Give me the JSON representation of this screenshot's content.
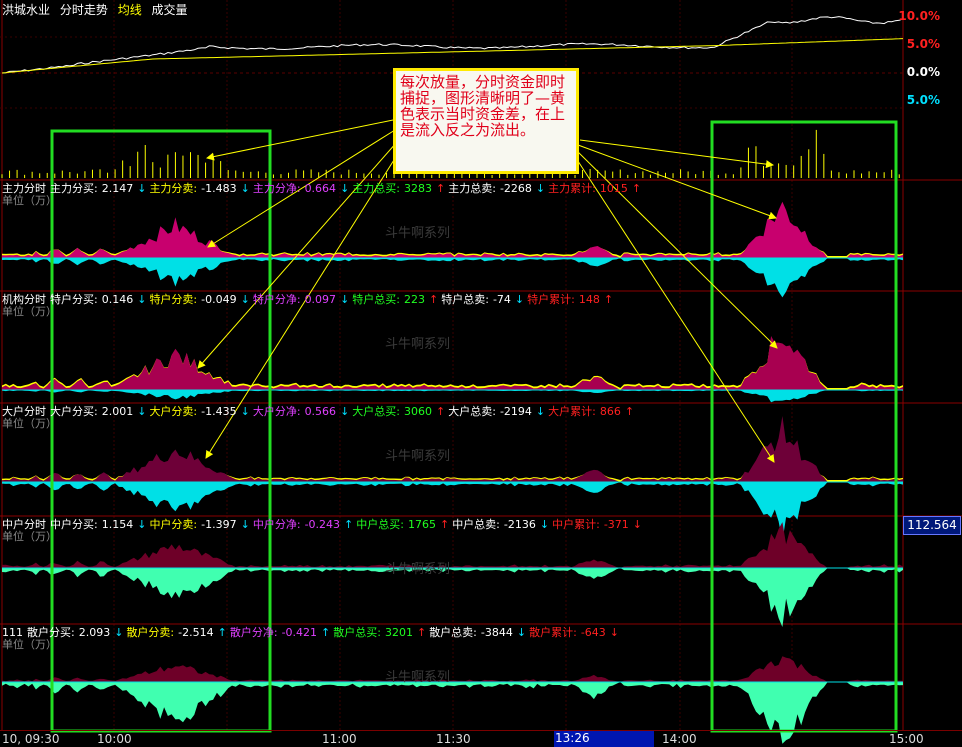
{
  "header": {
    "stock": "洪城水业",
    "tab_timeshare": "分时走势",
    "tab_avg": "均线",
    "tab_volume": "成交量"
  },
  "price_scale": {
    "up10": "10.0%",
    "up5": "5.0%",
    "zero": "0.0%",
    "dn5": "5.0%"
  },
  "panels": [
    {
      "title": "主力分时",
      "buy_label": "主力分买:",
      "buy": "2.147",
      "buy_arrow": "↓",
      "sell_label": "主力分卖:",
      "sell": "-1.483",
      "sell_arrow": "↓",
      "net_label": "主力分净:",
      "net": "0.664",
      "net_arrow": "↓",
      "tbuy_label": "主力总买:",
      "tbuy": "3283",
      "tbuy_arrow": "↑",
      "tsell_label": "主力总卖:",
      "tsell": "-2268",
      "tsell_arrow": "↓",
      "cum_label": "主力累计:",
      "cum": "1015",
      "cum_arrow": "↑",
      "unit": "单位（万）",
      "wm": "斗牛啊系列"
    },
    {
      "title": "机构分时",
      "buy_label": "特户分买:",
      "buy": "0.146",
      "buy_arrow": "↓",
      "sell_label": "特户分卖:",
      "sell": "-0.049",
      "sell_arrow": "↓",
      "net_label": "特户分净:",
      "net": "0.097",
      "net_arrow": "↓",
      "tbuy_label": "特户总买:",
      "tbuy": "223",
      "tbuy_arrow": "↑",
      "tsell_label": "特户总卖:",
      "tsell": "-74",
      "tsell_arrow": "↓",
      "cum_label": "特户累计:",
      "cum": "148",
      "cum_arrow": "↑",
      "unit": "单位（万）",
      "wm": "斗牛啊系列"
    },
    {
      "title": "大户分时",
      "buy_label": "大户分买:",
      "buy": "2.001",
      "buy_arrow": "↓",
      "sell_label": "大户分卖:",
      "sell": "-1.435",
      "sell_arrow": "↓",
      "net_label": "大户分净:",
      "net": "0.566",
      "net_arrow": "↓",
      "tbuy_label": "大户总买:",
      "tbuy": "3060",
      "tbuy_arrow": "↑",
      "tsell_label": "大户总卖:",
      "tsell": "-2194",
      "tsell_arrow": "↓",
      "cum_label": "大户累计:",
      "cum": "866",
      "cum_arrow": "↑",
      "unit": "单位（万）",
      "wm": "斗牛啊系列"
    },
    {
      "title": "中户分时",
      "buy_label": "中户分买:",
      "buy": "1.154",
      "buy_arrow": "↓",
      "sell_label": "中户分卖:",
      "sell": "-1.397",
      "sell_arrow": "↓",
      "net_label": "中户分净:",
      "net": "-0.243",
      "net_arrow": "↑",
      "tbuy_label": "中户总买:",
      "tbuy": "1765",
      "tbuy_arrow": "↑",
      "tsell_label": "中户总卖:",
      "tsell": "-2136",
      "tsell_arrow": "↓",
      "cum_label": "中户累计:",
      "cum": "-371",
      "cum_arrow": "↓",
      "unit": "单位（万）",
      "wm": "斗牛啊系列"
    },
    {
      "title": "111",
      "buy_label": "散户分买:",
      "buy": "2.093",
      "buy_arrow": "↓",
      "sell_label": "散户分卖:",
      "sell": "-2.514",
      "sell_arrow": "↑",
      "net_label": "散户分净:",
      "net": "-0.421",
      "net_arrow": "↑",
      "tbuy_label": "散户总买:",
      "tbuy": "3201",
      "tbuy_arrow": "↑",
      "tsell_label": "散户总卖:",
      "tsell": "-3844",
      "tsell_arrow": "↓",
      "cum_label": "散户累计:",
      "cum": "-643",
      "cum_arrow": "↓",
      "unit": "单位（万）",
      "wm": "斗牛啊系列"
    }
  ],
  "annotation": "每次放量，分时资金即时捕捉，图形清晰明了—黄色表示当时资金差，在上是流入反之为流出。",
  "price_tag": "112.564",
  "time_axis": {
    "start": "10, 09:30",
    "t1000": "10:00",
    "t1100": "11:00",
    "t1130": "11:30",
    "cursor": "13:26",
    "t1400": "14:00",
    "t1500": "15:00"
  },
  "colors": {
    "inflow": "#c8006e",
    "outflow": "#00e0e6",
    "diff": "#ffff00",
    "highlight_box": "#22dd22",
    "up": "#ff2020",
    "down": "#00e0ff"
  }
}
